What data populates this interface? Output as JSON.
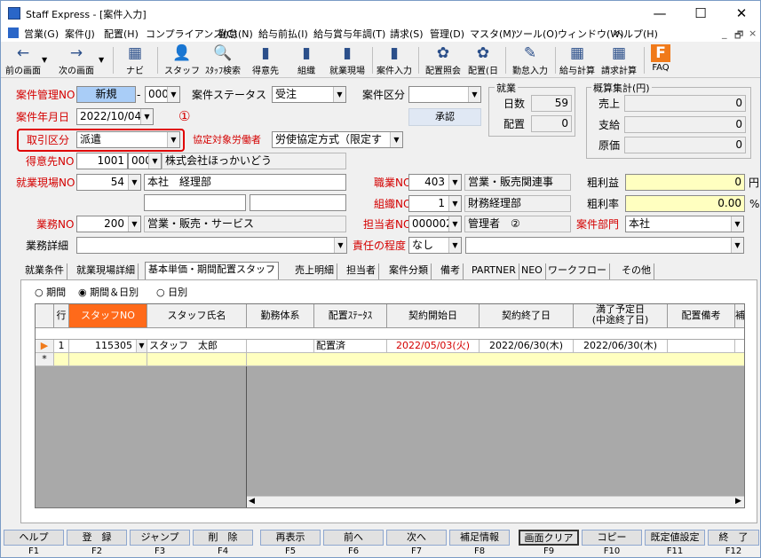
{
  "window": {
    "title": "Staff Express - [案件入力]",
    "minimize": "—",
    "maximize": "☐",
    "close": "✕"
  },
  "menu": [
    "営業(G)",
    "案件(J)",
    "配置(H)",
    "コンプライアンス(C)",
    "勤怠(N)",
    "給与前払(I)",
    "給与賞与年調(T)",
    "請求(S)",
    "管理(D)",
    "マスタ(M)",
    "ツール(O)",
    "ウィンドウ(W)",
    "ヘルプ(H)"
  ],
  "mdi_controls": [
    "_",
    "🗗",
    "×"
  ],
  "toolbar": [
    {
      "label": "前の画面",
      "icon": "←"
    },
    {
      "label": "次の画面",
      "icon": "→"
    },
    {
      "label": "ナビ",
      "icon": "▦"
    },
    {
      "label": "スタッフ",
      "icon": "👤"
    },
    {
      "label": "ｽﾀｯﾌ検索",
      "icon": "🔍"
    },
    {
      "label": "得意先",
      "icon": "▮"
    },
    {
      "label": "組織",
      "icon": "▮"
    },
    {
      "label": "就業現場",
      "icon": "▮"
    },
    {
      "label": "案件入力",
      "icon": "▮"
    },
    {
      "label": "配置照会",
      "icon": "✿"
    },
    {
      "label": "配置(日",
      "icon": "✿"
    },
    {
      "label": "勤怠入力",
      "icon": "✎"
    },
    {
      "label": "給与計算",
      "icon": "▦"
    },
    {
      "label": "請求計算",
      "icon": "▦"
    },
    {
      "label": "FAQ",
      "icon": "F"
    }
  ],
  "form": {
    "anken_no_label": "案件管理NO",
    "anken_no": "新規",
    "anken_no_sub": "000",
    "status_label": "案件ステータス",
    "status": "受注",
    "kubun_label": "案件区分",
    "kubun": "",
    "nengappi_label": "案件年月日",
    "nengappi": "2022/10/04",
    "annot1": "①",
    "torihiki_label": "取引区分",
    "torihiki": "派遣",
    "kyotei_label": "協定対象労働者",
    "kyotei": "労使協定方式（限定す",
    "shonin": "承認",
    "tokuisaki_label": "得意先NO",
    "tokuisaki_no": "1001",
    "tokuisaki_sub": "000",
    "tokuisaki_name": "株式会社ほっかいどう",
    "genba_label": "就業現場NO",
    "genba_no": "54",
    "genba_name": "本社　経理部",
    "shokushu_label": "職業NO",
    "shokushu_no": "403",
    "shokushu_name": "営業・販売関連事",
    "soshiki_label": "組織NO",
    "soshiki_no": "1",
    "soshiki_name": "財務経理部",
    "gyomu_label": "業務NO",
    "gyomu_no": "200",
    "gyomu_name": "営業・販売・サービス",
    "tanto_label": "担当者NO",
    "tanto_no": "000002",
    "tanto_name": "管理者　②",
    "bumon_label": "案件部門",
    "bumon": "本社",
    "shosai_label": "業務詳細",
    "shosai": "",
    "sekinin_label": "責任の程度",
    "sekinin": "なし",
    "sekinin_detail": "",
    "arari_label": "粗利益",
    "arari": "0",
    "arari_unit": "円",
    "ararit_label": "粗利率",
    "ararit": "0.00",
    "ararit_unit": "%"
  },
  "shugyo": {
    "title": "就業",
    "nissu_label": "日数",
    "nissu": "59",
    "haichi_label": "配置",
    "haichi": "0"
  },
  "gaisan": {
    "title": "概算集計(円)",
    "uriage_label": "売上",
    "uriage": "0",
    "shikyu_label": "支給",
    "shikyu": "0",
    "genka_label": "原価",
    "genka": "0"
  },
  "tabs": [
    "就業条件",
    "就業現場詳細",
    "基本単価・期間配置スタッフ",
    "売上明細",
    "担当者",
    "案件分類",
    "備考",
    "PARTNER",
    "NEO",
    "ワークフロー",
    "その他"
  ],
  "radios": [
    {
      "label": "期間",
      "checked": false
    },
    {
      "label": "期間＆日別",
      "checked": true
    },
    {
      "label": "日別",
      "checked": false
    }
  ],
  "grid": {
    "headers": [
      "行",
      "スタッフNO",
      "スタッフ氏名",
      "勤務体系",
      "配置ｽﾃｰﾀｽ",
      "契約開始日",
      "契約終了日",
      "満了予定日\n(中途終了日)",
      "配置備考",
      "補"
    ],
    "row": {
      "gyo": "1",
      "staff_no": "115305",
      "staff_name": "スタッフ　太郎",
      "kinmu": "",
      "status": "配置済",
      "start": "2022/05/03(火)",
      "end": "2022/06/30(木)",
      "manryo": "2022/06/30(木)",
      "biko": ""
    },
    "new_marker": "*",
    "current_marker": "▶"
  },
  "fkeys": [
    {
      "label": "ヘルプ",
      "key": "F1"
    },
    {
      "label": "登　録",
      "key": "F2"
    },
    {
      "label": "ジャンプ",
      "key": "F3"
    },
    {
      "label": "削　除",
      "key": "F4"
    },
    {
      "label": "再表示",
      "key": "F5"
    },
    {
      "label": "前へ",
      "key": "F6"
    },
    {
      "label": "次へ",
      "key": "F7"
    },
    {
      "label": "補足情報",
      "key": "F8"
    },
    {
      "label": "画面クリア",
      "key": "F9"
    },
    {
      "label": "コピー",
      "key": "F10"
    },
    {
      "label": "既定値設定",
      "key": "F11"
    },
    {
      "label": "終　了",
      "key": "F12"
    }
  ],
  "colors": {
    "accent_red": "#d40000",
    "highlight_box": "#e00000",
    "new_field_bg": "#a9cdf7",
    "yellow_bg": "#ffffc0",
    "staff_no_header": "#ff6a1a"
  }
}
